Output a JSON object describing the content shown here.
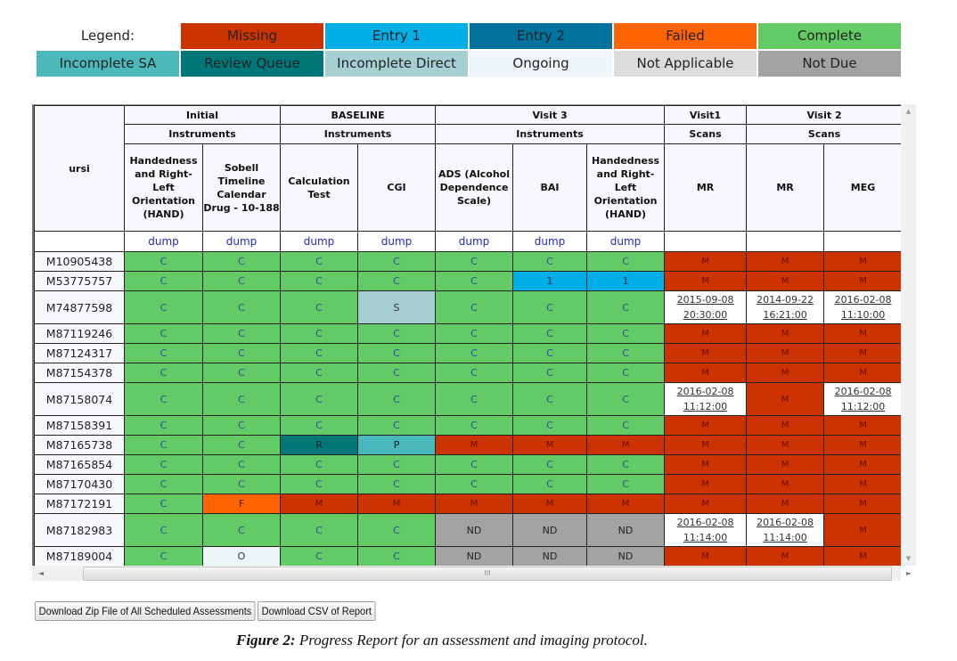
{
  "legend": {
    "label": "Legend:",
    "items": [
      {
        "label": "Missing",
        "color": "#cc3300"
      },
      {
        "label": "Entry 1",
        "color": "#00aee8"
      },
      {
        "label": "Entry 2",
        "color": "#00739f"
      },
      {
        "label": "Failed",
        "color": "#ff6400"
      },
      {
        "label": "Complete",
        "color": "#63cb65"
      },
      {
        "label": "Incomplete SA",
        "color": "#4cb8bb"
      },
      {
        "label": "Review Queue",
        "color": "#00787a"
      },
      {
        "label": "Incomplete Direct",
        "color": "#a5cfd0"
      },
      {
        "label": "Ongoing",
        "color": "#eef6f8"
      },
      {
        "label": "Not Applicable",
        "color": "#dcdcdc"
      },
      {
        "label": "Not Due",
        "color": "#a4a3a4"
      }
    ]
  },
  "table": {
    "id_header": "ursi",
    "visits": [
      {
        "label": "Initial",
        "group": "Instruments",
        "span": 2
      },
      {
        "label": "BASELINE",
        "group": "Instruments",
        "span": 2
      },
      {
        "label": "Visit 3",
        "group": "Instruments",
        "span": 3
      },
      {
        "label": "Visit1",
        "group": "Scans",
        "span": 1
      },
      {
        "label": "Visit 2",
        "group": "Scans",
        "span": 2
      }
    ],
    "columns": [
      {
        "label": "Handedness and Right-Left Orientation (HAND)",
        "dump": "dump"
      },
      {
        "label": "Sobell Timeline Calendar Drug - 10-188",
        "dump": "dump"
      },
      {
        "label": "Calculation Test",
        "dump": "dump"
      },
      {
        "label": "CGI",
        "dump": "dump"
      },
      {
        "label": "ADS (Alcohol Dependence Scale)",
        "dump": "dump"
      },
      {
        "label": "BAI",
        "dump": "dump"
      },
      {
        "label": "Handedness and Right-Left Orientation (HAND)",
        "dump": "dump"
      },
      {
        "label": "MR",
        "dump": ""
      },
      {
        "label": "MR",
        "dump": ""
      },
      {
        "label": "MEG",
        "dump": ""
      }
    ],
    "rows": [
      {
        "id": "M10905438",
        "cells": [
          "C",
          "C",
          "C",
          "C",
          "C",
          "C",
          "C",
          "M",
          "M",
          "M"
        ]
      },
      {
        "id": "M53775757",
        "cells": [
          "C",
          "C",
          "C",
          "C",
          "C",
          "1",
          "1",
          "M",
          "M",
          "M"
        ]
      },
      {
        "id": "M74877598",
        "cells": [
          "C",
          "C",
          "C",
          "S",
          "C",
          "C",
          "C",
          "2015-09-08 20:30:00",
          "2014-09-22 16:21:00",
          "2016-02-08 11:10:00"
        ]
      },
      {
        "id": "M87119246",
        "cells": [
          "C",
          "C",
          "C",
          "C",
          "C",
          "C",
          "C",
          "M",
          "M",
          "M"
        ]
      },
      {
        "id": "M87124317",
        "cells": [
          "C",
          "C",
          "C",
          "C",
          "C",
          "C",
          "C",
          "M",
          "M",
          "M"
        ]
      },
      {
        "id": "M87154378",
        "cells": [
          "C",
          "C",
          "C",
          "C",
          "C",
          "C",
          "C",
          "M",
          "M",
          "M"
        ]
      },
      {
        "id": "M87158074",
        "cells": [
          "C",
          "C",
          "C",
          "C",
          "C",
          "C",
          "C",
          "2016-02-08 11:12:00",
          "M",
          "2016-02-08 11:12:00"
        ]
      },
      {
        "id": "M87158391",
        "cells": [
          "C",
          "C",
          "C",
          "C",
          "C",
          "C",
          "C",
          "M",
          "M",
          "M"
        ]
      },
      {
        "id": "M87165738",
        "cells": [
          "C",
          "C",
          "R",
          "P",
          "M",
          "M",
          "M",
          "M",
          "M",
          "M"
        ]
      },
      {
        "id": "M87165854",
        "cells": [
          "C",
          "C",
          "C",
          "C",
          "C",
          "C",
          "C",
          "M",
          "M",
          "M"
        ]
      },
      {
        "id": "M87170430",
        "cells": [
          "C",
          "C",
          "C",
          "C",
          "C",
          "C",
          "C",
          "M",
          "M",
          "M"
        ]
      },
      {
        "id": "M87172191",
        "cells": [
          "C",
          "F",
          "M",
          "M",
          "M",
          "M",
          "M",
          "M",
          "M",
          "M"
        ]
      },
      {
        "id": "M87182983",
        "cells": [
          "C",
          "C",
          "C",
          "C",
          "ND",
          "ND",
          "ND",
          "2016-02-08 11:14:00",
          "2016-02-08 11:14:00",
          "M"
        ]
      },
      {
        "id": "M87189004",
        "cells": [
          "C",
          "O",
          "C",
          "C",
          "ND",
          "ND",
          "ND",
          "M",
          "M",
          "M"
        ]
      }
    ]
  },
  "scrollbar": {
    "grip": "III",
    "left_arrow": "◄",
    "right_arrow": "►",
    "up_arrow": "▲",
    "down_arrow": "▼"
  },
  "buttons": {
    "zip": "Download Zip File of All Scheduled Assessments",
    "csv": "Download CSV of Report"
  },
  "caption": {
    "prefix": "Figure 2:",
    "text": " Progress Report for an assessment and imaging protocol."
  }
}
